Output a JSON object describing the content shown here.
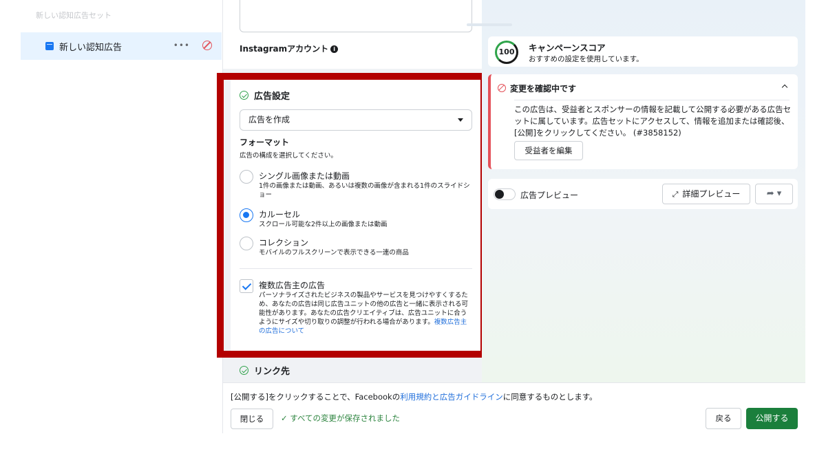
{
  "sidebar": {
    "faded_item": "新しい認知広告セット",
    "active_item": {
      "label": "新しい認知広告",
      "more": "•••",
      "status_icon": "ban-icon"
    }
  },
  "editor": {
    "instagram_label": "Instagramアカウント",
    "ad_setup": {
      "title": "広告設定",
      "select_value": "広告を作成",
      "format_title": "フォーマット",
      "format_sub": "広告の構成を選択してください。",
      "options": [
        {
          "title": "シングル画像または動画",
          "desc": "1件の画像または動画、あるいは複数の画像が含まれる1件のスライドショー",
          "selected": false
        },
        {
          "title": "カルーセル",
          "desc": "スクロール可能な2件以上の画像または動画",
          "selected": true
        },
        {
          "title": "コレクション",
          "desc": "モバイルのフルスクリーンで表示できる一連の商品",
          "selected": false
        }
      ],
      "multi_advertiser": {
        "title": "複数広告主の広告",
        "checked": true,
        "desc": "パーソナライズされたビジネスの製品やサービスを見つけやすくするため、あなたの広告は同じ広告ユニットの他の広告と一緒に表示される可能性があります。あなたの広告クリエイティブは、広告ユニットに合うようにサイズや切り取りの調整が行われる場合があります。",
        "link": "複数広告主の広告について"
      }
    },
    "link_section_title": "リンク先"
  },
  "preview": {
    "score": {
      "value": "100",
      "title": "キャンペーンスコア",
      "subtitle": "おすすめの設定を使用しています。"
    },
    "review": {
      "title": "変更を確認中です",
      "body": "この広告は、受益者とスポンサーの情報を記載して公開する必要がある広告セットに属しています。広告セットにアクセスして、情報を追加または確認後、[公開]をクリックしてください。 (#3858152)",
      "button": "受益者を編集"
    },
    "bar": {
      "toggle_label": "広告プレビュー",
      "detail_button": "詳細プレビュー",
      "share_icon": "share-icon"
    }
  },
  "footer": {
    "agree_prefix": "[公開する]をクリックすることで、Facebookの",
    "agree_link1": "利用規約",
    "agree_mid": "と",
    "agree_link2": "広告ガイドライン",
    "agree_suffix": "に同意するものとします。",
    "close": "閉じる",
    "saved": "すべての変更が保存されました",
    "back": "戻る",
    "publish": "公開する"
  },
  "colors": {
    "accent": "#1877f2",
    "publish": "#1b7f3c",
    "highlight": "#b30000",
    "error": "#e4525a",
    "success": "#31a24c"
  }
}
